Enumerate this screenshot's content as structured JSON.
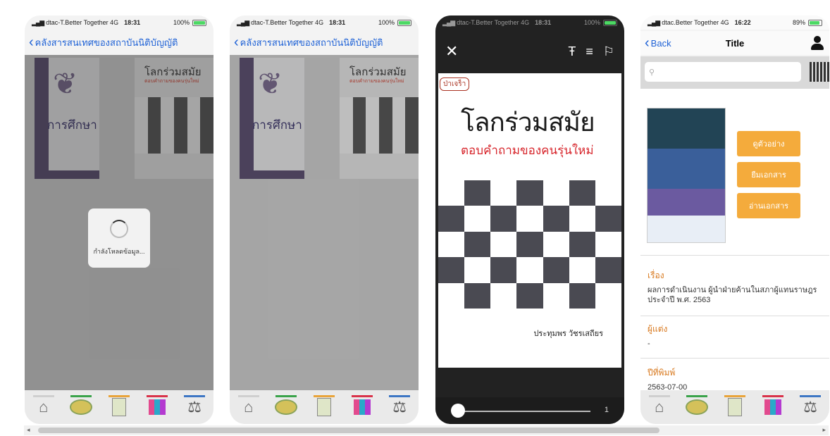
{
  "phone1": {
    "status": {
      "carrier": "dtac-T.Better Together",
      "network": "4G",
      "time": "18:31",
      "battery": "100%"
    },
    "nav_back_label": "คลังสารสนเทศของสถาบันนิติบัญญัติ",
    "book_a_title": "การศึกษา",
    "book_b_title": "โลกร่วมสมัย",
    "book_b_subtitle": "ตอบคำถามของคนรุ่นใหม่",
    "loading_text": "กำลังโหลดข้อมูล..."
  },
  "phone2": {
    "status": {
      "carrier": "dtac-T.Better Together",
      "network": "4G",
      "time": "18:31",
      "battery": "100%"
    },
    "nav_back_label": "คลังสารสนเทศของสถาบันนิติบัญญัติ",
    "book_a_title": "การศึกษา",
    "book_b_title": "โลกร่วมสมัย",
    "book_b_subtitle": "ตอบคำถามของคนรุ่นใหม่"
  },
  "phone3": {
    "status": {
      "carrier": "dtac-T.Better Together",
      "network": "4G",
      "time": "18:31",
      "battery": "100%"
    },
    "page_tag": "ป่าเจร็า",
    "book_title": "โลกร่วมสมัย",
    "book_subtitle": "ตอบคำถามของคนรุ่นใหม่",
    "author": "ประทุมพร วัชรเสถียร",
    "page_number": "1",
    "slider_progress": 0.0
  },
  "phone4": {
    "status": {
      "carrier": "dtac.Better Together",
      "network": "4G",
      "time": "16:22",
      "battery": "89%"
    },
    "nav_back_label": "Back",
    "nav_title": "Title",
    "search_placeholder": "",
    "buttons": [
      "ดูตัวอย่าง",
      "ยืมเอกสาร",
      "อ่านเอกสาร"
    ],
    "fields": [
      {
        "label": "เรื่อง",
        "value": "ผลการดำเนินงาน ผู้นำฝ่ายค้านในสภาผู้แทนราษฎร ประจำปี พ.ศ. 2563"
      },
      {
        "label": "ผู้แต่ง",
        "value": "-"
      },
      {
        "label": "ปีที่พิมพ์",
        "value": "2563-07-00"
      }
    ]
  },
  "tabbar_icons": [
    "home-icon",
    "arena-icon",
    "document-icon",
    "books-icon",
    "scale-icon"
  ],
  "tabbar_colors": [
    "#cfcfcf",
    "#3aa34a",
    "#e9a43a",
    "#d9334a",
    "#3d76c4"
  ],
  "glyphs": {
    "home": "⌂",
    "scale": "⚖",
    "close": "✕",
    "text_settings": "Ŧ",
    "list": "≡",
    "bookmark": "⚐",
    "chevron": "‹",
    "search": "⚲",
    "scroll_left": "◂",
    "scroll_right": "▸"
  }
}
